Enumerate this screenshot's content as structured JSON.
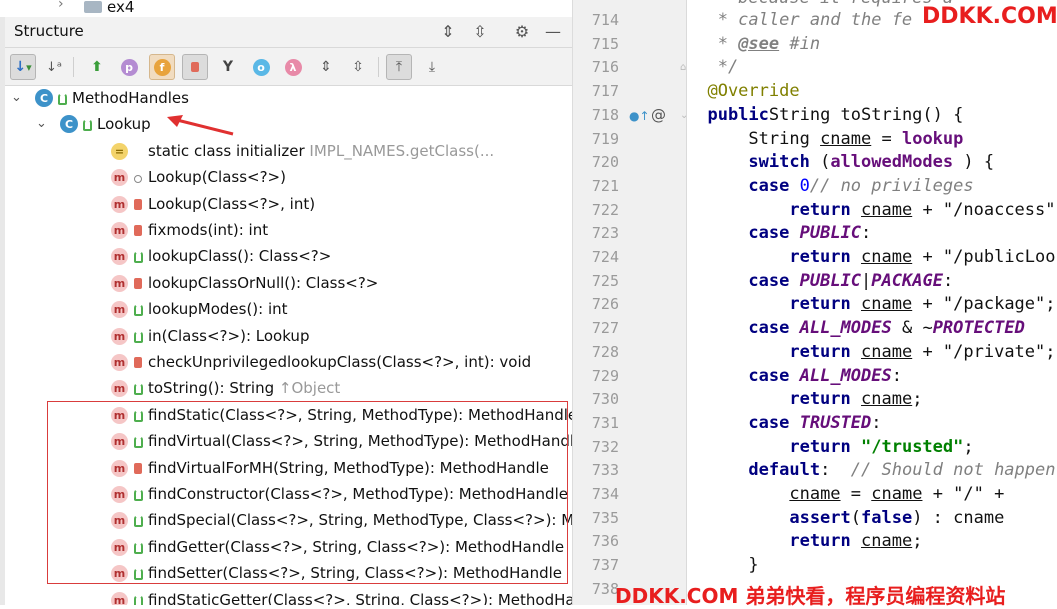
{
  "project": {
    "folder": "ex4"
  },
  "structure": {
    "title": "Structure"
  },
  "tree": [
    {
      "label": "MethodHandles",
      "type": "class",
      "visibility": "public",
      "indent": 0,
      "expanded": true
    },
    {
      "label": "Lookup",
      "type": "class",
      "visibility": "public",
      "indent": 1,
      "expanded": true
    },
    {
      "label": "static class initializer",
      "suffix": "IMPL_NAMES.getClass(...",
      "type": "init",
      "visibility": "",
      "indent": 2
    },
    {
      "label": "Lookup(Class<?>)",
      "type": "method",
      "visibility": "package",
      "indent": 2
    },
    {
      "label": "Lookup(Class<?>, int)",
      "type": "method",
      "visibility": "private",
      "indent": 2
    },
    {
      "label": "fixmods(int): int",
      "type": "method-static",
      "visibility": "private",
      "indent": 2
    },
    {
      "label": "lookupClass(): Class<?>",
      "type": "method",
      "visibility": "public",
      "indent": 2
    },
    {
      "label": "lookupClassOrNull(): Class<?>",
      "type": "method",
      "visibility": "private",
      "indent": 2
    },
    {
      "label": "lookupModes(): int",
      "type": "method",
      "visibility": "public",
      "indent": 2
    },
    {
      "label": "in(Class<?>): Lookup",
      "type": "method",
      "visibility": "public",
      "indent": 2
    },
    {
      "label": "checkUnprivilegedlookupClass(Class<?>, int): void",
      "type": "method-static",
      "visibility": "private",
      "indent": 2
    },
    {
      "label": "toString(): String",
      "suffix": "↑Object",
      "type": "method",
      "visibility": "public",
      "indent": 2
    },
    {
      "label": "findStatic(Class<?>, String, MethodType): MethodHandle",
      "type": "method",
      "visibility": "public",
      "indent": 2
    },
    {
      "label": "findVirtual(Class<?>, String, MethodType): MethodHandle",
      "type": "method",
      "visibility": "public",
      "indent": 2
    },
    {
      "label": "findVirtualForMH(String, MethodType): MethodHandle",
      "type": "method",
      "visibility": "private",
      "indent": 2
    },
    {
      "label": "findConstructor(Class<?>, MethodType): MethodHandle",
      "type": "method",
      "visibility": "public",
      "indent": 2
    },
    {
      "label": "findSpecial(Class<?>, String, MethodType, Class<?>): MethodHandle",
      "type": "method",
      "visibility": "public",
      "indent": 2
    },
    {
      "label": "findGetter(Class<?>, String, Class<?>): MethodHandle",
      "type": "method",
      "visibility": "public",
      "indent": 2
    },
    {
      "label": "findSetter(Class<?>, String, Class<?>): MethodHandle",
      "type": "method",
      "visibility": "public",
      "indent": 2
    },
    {
      "label": "findStaticGetter(Class<?>, String, Class<?>): MethodHandle",
      "type": "method",
      "visibility": "public",
      "indent": 2
    }
  ],
  "editor": {
    "line_numbers": [
      "714",
      "715",
      "716",
      "717",
      "718",
      "719",
      "720",
      "721",
      "722",
      "723",
      "724",
      "725",
      "726",
      "727",
      "728",
      "729",
      "730",
      "731",
      "732",
      "733",
      "734",
      "735",
      "736",
      "737",
      "738"
    ],
    "lines": [
      [
        [
          "cm",
          "   * caller and the fe"
        ]
      ],
      [
        [
          "cm",
          "   * "
        ],
        [
          "cm tag",
          "@see"
        ],
        [
          "cm",
          " #in"
        ]
      ],
      [
        [
          "cm",
          "   */"
        ]
      ],
      [
        [
          "an",
          "  @Override"
        ]
      ],
      [
        [
          "kw",
          "  public"
        ],
        [
          "",
          "String toString() {"
        ]
      ],
      [
        [
          "",
          "      String "
        ],
        [
          "ul",
          "cname"
        ],
        [
          "",
          " = "
        ],
        [
          "fld",
          "lookup"
        ]
      ],
      [
        [
          "kw",
          "      switch"
        ],
        [
          "",
          " ("
        ],
        [
          "fld",
          "allowedModes"
        ],
        [
          "",
          " ) {"
        ]
      ],
      [
        [
          "kw",
          "      case"
        ],
        [
          "",
          " "
        ],
        [
          "num",
          "0"
        ],
        [
          ":  "
        ],
        [
          "cm",
          "// no privileges"
        ]
      ],
      [
        [
          "kw",
          "          return"
        ],
        [
          "",
          " "
        ],
        [
          "ul",
          "cname"
        ],
        [
          "",
          " + \"/noaccess\";"
        ]
      ],
      [
        [
          "kw",
          "      case"
        ],
        [
          "",
          " "
        ],
        [
          "const",
          "PUBLIC"
        ],
        [
          "",
          ":"
        ]
      ],
      [
        [
          "kw",
          "          return"
        ],
        [
          "",
          " "
        ],
        [
          "ul",
          "cname"
        ],
        [
          "",
          " + \"/publicLookup\";"
        ]
      ],
      [
        [
          "kw",
          "      case"
        ],
        [
          "",
          " "
        ],
        [
          "const",
          "PUBLIC"
        ],
        [
          "",
          "|"
        ],
        [
          "const",
          "PACKAGE"
        ],
        [
          "",
          ": "
        ]
      ],
      [
        [
          "kw",
          "          return"
        ],
        [
          "",
          " "
        ],
        [
          "ul",
          "cname"
        ],
        [
          "",
          " + \"/package\";"
        ]
      ],
      [
        [
          "kw",
          "      case"
        ],
        [
          "",
          " "
        ],
        [
          "const",
          "ALL_MODES"
        ],
        [
          "",
          " & ~"
        ],
        [
          "const",
          "PROTECTED"
        ]
      ],
      [
        [
          "kw",
          "          return"
        ],
        [
          "",
          " "
        ],
        [
          "ul",
          "cname"
        ],
        [
          "",
          " + \"/private\";"
        ]
      ],
      [
        [
          "kw",
          "      case"
        ],
        [
          "",
          " "
        ],
        [
          "const",
          "ALL_MODES"
        ],
        [
          "",
          ":"
        ]
      ],
      [
        [
          "kw",
          "          return"
        ],
        [
          "",
          " "
        ],
        [
          "ul",
          "cname"
        ],
        [
          "",
          ";"
        ]
      ],
      [
        [
          "kw",
          "      case"
        ],
        [
          "",
          " "
        ],
        [
          "const",
          "TRUSTED"
        ],
        [
          "",
          ":"
        ]
      ],
      [
        [
          "kw",
          "          return"
        ],
        [
          "",
          " "
        ],
        [
          "str",
          "\"/trusted\""
        ],
        [
          "",
          ";"
        ]
      ],
      [
        [
          "kw",
          "      default"
        ],
        [
          "",
          ":  "
        ],
        [
          "cm",
          "// Should not happen"
        ]
      ],
      [
        [
          "",
          "          "
        ],
        [
          "ul",
          "cname"
        ],
        [
          "",
          " = "
        ],
        [
          "ul",
          "cname"
        ],
        [
          "",
          " + \"/\" + "
        ]
      ],
      [
        [
          "kw",
          "          assert"
        ],
        [
          "",
          "("
        ],
        [
          "kw",
          "false"
        ],
        [
          "",
          ") : cname"
        ]
      ],
      [
        [
          "kw",
          "          return"
        ],
        [
          "",
          " "
        ],
        [
          "ul",
          "cname"
        ],
        [
          "",
          ";"
        ]
      ],
      [
        [
          "",
          "      }"
        ]
      ],
      [
        [
          "",
          ""
        ]
      ]
    ],
    "top_partial_comment": "   * because it requires a"
  },
  "watermark": {
    "top": "DDKK.COM",
    "bottom": "DDKK.COM 弟弟快看，程序员编程资料站"
  },
  "colors": {
    "highlight_box": "#d93c3c",
    "watermark": "#e81e1e"
  }
}
